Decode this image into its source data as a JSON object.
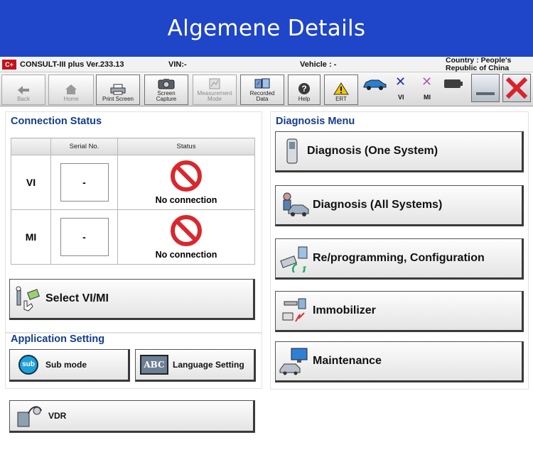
{
  "banner": {
    "title": "Algemene Details"
  },
  "titlebar": {
    "logo": "C+",
    "app": "CONSULT-III plus   Ver.233.13",
    "vin": "VIN:-",
    "vehicle": "Vehicle : -",
    "country": "Country : People's Republic of China"
  },
  "toolbar": {
    "back": "Back",
    "home": "Home",
    "print_screen": "Print Screen",
    "screen_capture_1": "Screen",
    "screen_capture_2": "Capture",
    "measurement_mode_1": "Measurement",
    "measurement_mode_2": "Mode",
    "recorded_data_1": "Recorded",
    "recorded_data_2": "Data",
    "help": "Help",
    "ert": "ERT",
    "vi": "VI",
    "mi": "MI",
    "status_colors": {
      "vi_x": "#1a2fb0",
      "mi_x": "#b45ab8",
      "close": "#d8232a"
    }
  },
  "connection_status": {
    "title": "Connection Status",
    "col_serial": "Serial No.",
    "col_status": "Status",
    "rows": [
      {
        "label": "VI",
        "serial": "-",
        "status": "No connection"
      },
      {
        "label": "MI",
        "serial": "-",
        "status": "No connection"
      }
    ],
    "select_button": "Select VI/MI"
  },
  "application_setting": {
    "title": "Application Setting",
    "sub_mode": "Sub mode",
    "sub_icon_text": "sub",
    "language_setting": "Language Setting",
    "abc_icon_text": "ABC"
  },
  "vdr": {
    "label": "VDR"
  },
  "diagnosis_menu": {
    "title": "Diagnosis Menu",
    "items": [
      {
        "label": "Diagnosis (One System)",
        "icon": "ecu-module-icon"
      },
      {
        "label": "Diagnosis (All Systems)",
        "icon": "mechanic-car-icon"
      },
      {
        "label": "Re/programming, Configuration",
        "icon": "reprogramming-icon"
      },
      {
        "label": "Immobilizer",
        "icon": "key-icon"
      },
      {
        "label": "Maintenance",
        "icon": "maintenance-car-icon"
      }
    ]
  },
  "colors": {
    "banner": "#1f45c8",
    "section_title": "#143d8e",
    "no_connection": "#d8282e"
  }
}
